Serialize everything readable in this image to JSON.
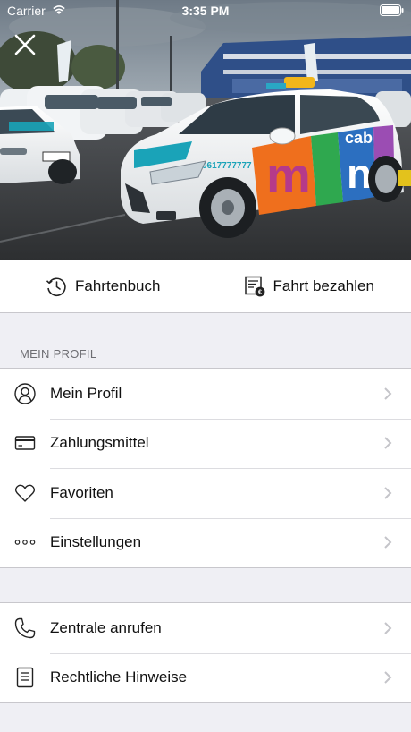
{
  "status_bar": {
    "carrier": "Carrier",
    "time": "3:35 PM"
  },
  "hero": {
    "image": "taxi-fleet-photo",
    "car_text": {
      "phone": "0617777777",
      "brand": "min cab"
    }
  },
  "actions": [
    {
      "label": "Fahrtenbuch",
      "icon": "history-icon"
    },
    {
      "label": "Fahrt bezahlen",
      "icon": "receipt-pay-icon"
    }
  ],
  "profile_section": {
    "header": "MEIN PROFIL",
    "items": [
      {
        "label": "Mein Profil",
        "icon": "user-icon"
      },
      {
        "label": "Zahlungsmittel",
        "icon": "credit-card-icon"
      },
      {
        "label": "Favoriten",
        "icon": "heart-icon"
      },
      {
        "label": "Einstellungen",
        "icon": "more-dots-icon"
      }
    ]
  },
  "support_section": {
    "items": [
      {
        "label": "Zentrale anrufen",
        "icon": "phone-icon"
      },
      {
        "label": "Rechtliche Hinweise",
        "icon": "document-icon"
      }
    ]
  },
  "colors": {
    "background": "#efeff4",
    "separator": "#c8c7cc",
    "chevron": "#c4c4c9",
    "text": "#111111",
    "section_header": "#6d6d72"
  }
}
